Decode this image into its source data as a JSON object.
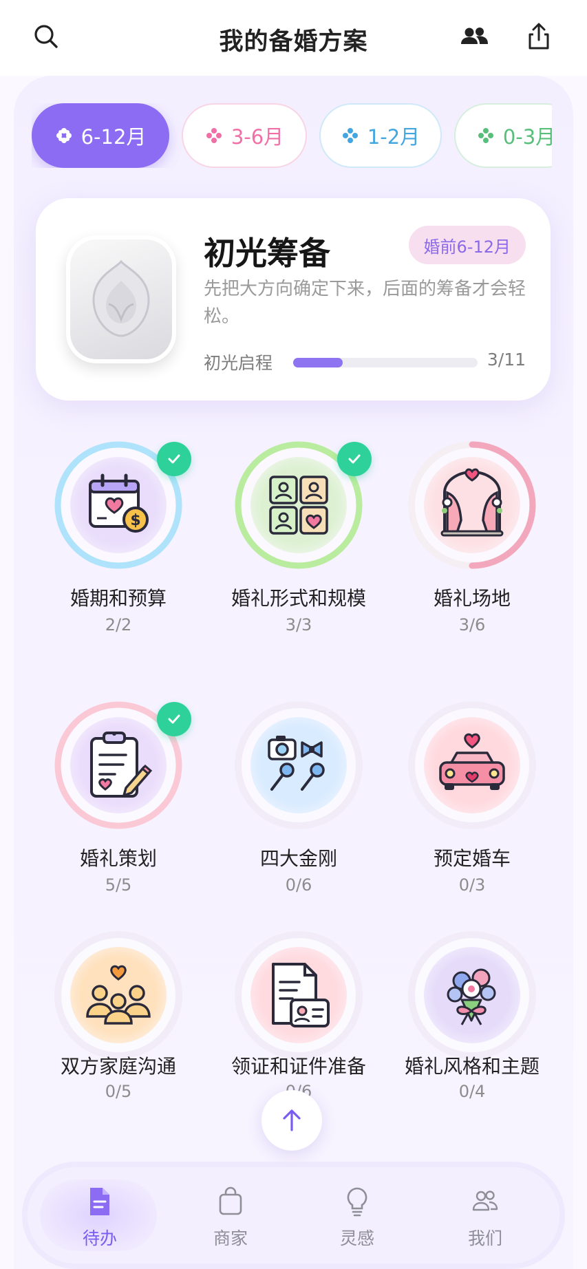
{
  "header": {
    "title": "我的备婚方案"
  },
  "chips": [
    {
      "label": "6-12月",
      "active": true,
      "color": "#8b6cf2"
    },
    {
      "label": "3-6月",
      "active": false,
      "color": "#ef6fa6"
    },
    {
      "label": "1-2月",
      "active": false,
      "color": "#44a6e0"
    },
    {
      "label": "0-3月",
      "active": false,
      "color": "#58bf7a"
    }
  ],
  "stage": {
    "title": "初光筹备",
    "pill": "婚前6-12月",
    "description": "先把大方向确定下来，后面的筹备才会轻松。",
    "progress_label": "初光启程",
    "progress_count": "3/11",
    "progress_fraction": 0.27
  },
  "tasks": [
    {
      "name": "婚期和预算",
      "count": "2/2",
      "done": true,
      "progress": 1.0,
      "ring_color": "#aee3fb",
      "icon": "calendar-budget-icon"
    },
    {
      "name": "婚礼形式和规模",
      "count": "3/3",
      "done": true,
      "progress": 1.0,
      "ring_color": "#b9ec9e",
      "icon": "guest-grid-icon"
    },
    {
      "name": "婚礼场地",
      "count": "3/6",
      "done": false,
      "progress": 0.5,
      "ring_color": "#f3a7bd",
      "icon": "wedding-arch-icon"
    },
    {
      "name": "婚礼策划",
      "count": "5/5",
      "done": true,
      "progress": 1.0,
      "ring_color": "#fbc9d6",
      "icon": "clipboard-plan-icon"
    },
    {
      "name": "四大金刚",
      "count": "0/6",
      "done": false,
      "progress": 0,
      "ring_color": "#eeeaf6",
      "icon": "camera-mic-icon"
    },
    {
      "name": "预定婚车",
      "count": "0/3",
      "done": false,
      "progress": 0,
      "ring_color": "#eeeaf6",
      "icon": "wedding-car-icon"
    },
    {
      "name": "双方家庭沟通",
      "count": "0/5",
      "done": false,
      "progress": 0,
      "ring_color": "#eeeaf6",
      "icon": "family-icon"
    },
    {
      "name": "领证和证件准备",
      "count": "0/6",
      "done": false,
      "progress": 0,
      "ring_color": "#eeeaf6",
      "icon": "documents-icon"
    },
    {
      "name": "婚礼风格和主题",
      "count": "0/4",
      "done": false,
      "progress": 0,
      "ring_color": "#eeeaf6",
      "icon": "bouquet-icon"
    }
  ],
  "nav": [
    {
      "label": "待办",
      "icon": "todo-doc-icon",
      "active": true
    },
    {
      "label": "商家",
      "icon": "shopping-bag-icon",
      "active": false
    },
    {
      "label": "灵感",
      "icon": "lightbulb-icon",
      "active": false
    },
    {
      "label": "我们",
      "icon": "people-icon",
      "active": false
    }
  ],
  "colors": {
    "accent": "#8b6cf2",
    "check": "#2fd19b"
  }
}
